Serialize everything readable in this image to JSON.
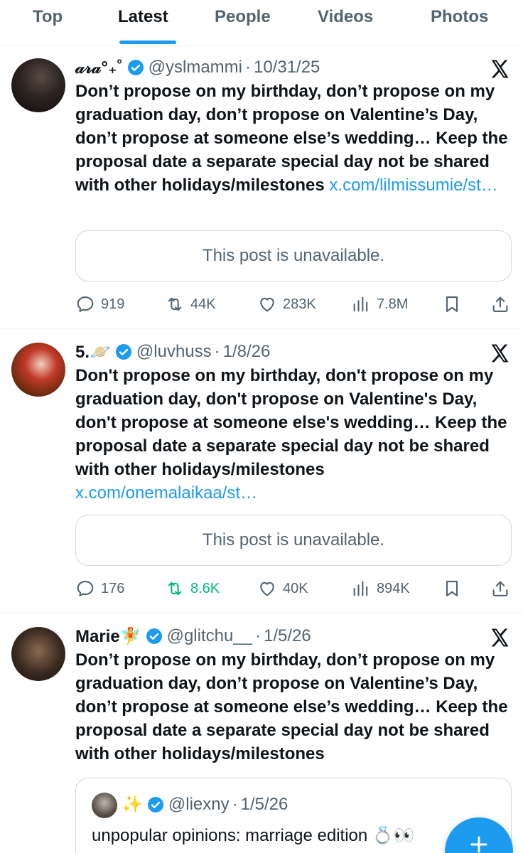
{
  "tabs": [
    {
      "label": "Top"
    },
    {
      "label": "Latest"
    },
    {
      "label": "People"
    },
    {
      "label": "Videos"
    },
    {
      "label": "Photos"
    }
  ],
  "active_tab": "Latest",
  "colors": {
    "accent": "#1d9bf0",
    "secondary_text": "#536471",
    "repost_active": "#00ba7c"
  },
  "posts": [
    {
      "name": "𝒶𝓇𝒶°₊˚",
      "handle": "@yslmammi",
      "date": "10/31/25",
      "text": "Don’t propose on my birthday, don’t propose on my graduation day, don’t propose on Valentine’s Day, don’t propose at someone else’s wedding… Keep the proposal date a separate special day not be shared with other holidays/milestones ",
      "link": "x.com/lilmissumie/st…",
      "quote_unavailable": "This post is unavailable.",
      "replies": "919",
      "reposts": "44K",
      "likes": "283K",
      "views": "7.8M"
    },
    {
      "name": "5.🪐",
      "handle": "@luvhuss",
      "date": "1/8/26",
      "text": "Don't propose on my birthday, don't propose on my graduation day, don't propose on Valentine's Day, don't propose at someone else's wedding… Keep the proposal date a separate special day not be shared with other holidays/milestones ",
      "link": "x.com/onemalaikaa/st…",
      "quote_unavailable": "This post is unavailable.",
      "replies": "176",
      "reposts": "8.6K",
      "likes": "40K",
      "views": "894K"
    },
    {
      "name": "Marie🧚",
      "handle": "@glitchu__",
      "date": "1/5/26",
      "text": "Don’t propose on my birthday, don’t propose on my graduation day, don’t propose on Valentine’s Day, don’t propose at someone else’s wedding… Keep the proposal date a separate special day not be shared with other holidays/milestones",
      "quote": {
        "name": "✨",
        "handle": "@liexny",
        "date": "1/5/26",
        "text": "unpopular opinions: marriage edition 💍👀"
      }
    }
  ],
  "icons": {
    "reply": "reply-icon",
    "repost": "repost-icon",
    "like": "heart-icon",
    "views": "views-icon",
    "bookmark": "bookmark-icon",
    "share": "share-icon",
    "close": "x-logo-icon",
    "compose": "plus-icon"
  }
}
